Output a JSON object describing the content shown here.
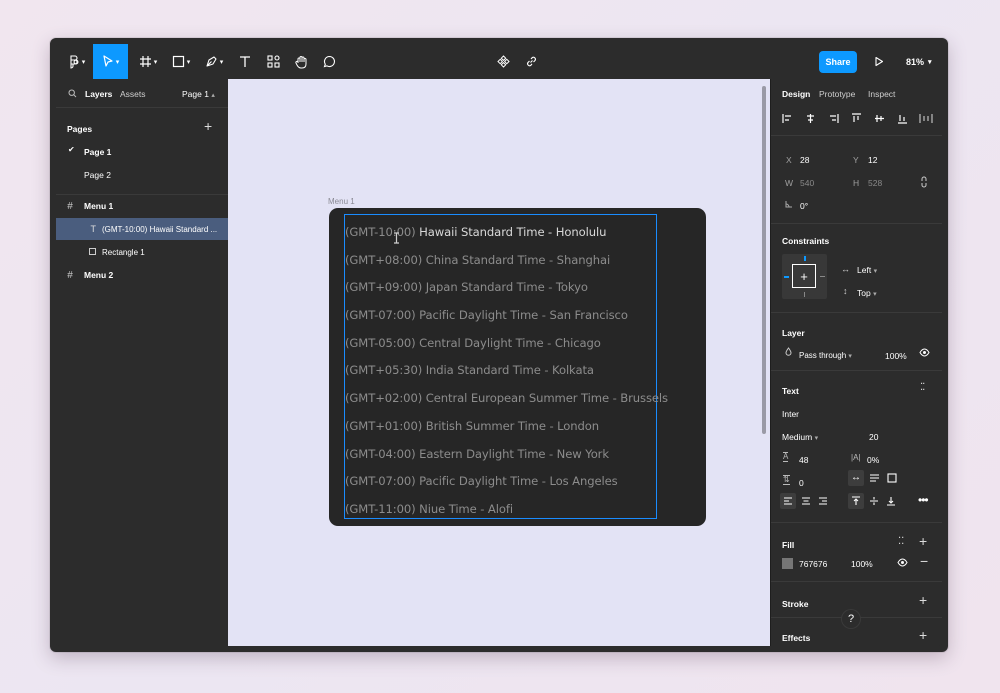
{
  "toolbar": {
    "share_label": "Share",
    "zoom_label": "81%"
  },
  "left_panel": {
    "tabs": {
      "layers": "Layers",
      "assets": "Assets",
      "page_selector": "Page 1"
    },
    "pages_title": "Pages",
    "pages": [
      "Page 1",
      "Page 2"
    ],
    "layers": [
      {
        "name": "Menu 1",
        "type": "frame"
      },
      {
        "name": "(GMT-10:00) Hawaii Standard ...",
        "type": "text",
        "selected": true
      },
      {
        "name": "Rectangle 1",
        "type": "rectangle"
      },
      {
        "name": "Menu 2",
        "type": "frame"
      }
    ]
  },
  "canvas": {
    "frame_label": "Menu 1",
    "timezones": [
      "(GMT-10:00) Hawaii Standard Time - Honolulu",
      "(GMT+08:00) China Standard Time - Shanghai",
      "(GMT+09:00) Japan Standard Time - Tokyo",
      "(GMT-07:00) Pacific Daylight Time - San Francisco",
      "(GMT-05:00) Central Daylight Time - Chicago",
      "(GMT+05:30) India Standard Time - Kolkata",
      "(GMT+02:00) Central European Summer Time - Brussels",
      "(GMT+01:00) British Summer Time - London",
      "(GMT-04:00) Eastern Daylight Time - New York",
      "(GMT-07:00) Pacific Daylight Time - Los Angeles",
      "(GMT-11:00) Niue Time - Alofi"
    ],
    "first_prefix": "(GMT-10:00)",
    "first_rest": " Hawaii Standard Time - Honolulu"
  },
  "right_panel": {
    "tabs": {
      "design": "Design",
      "prototype": "Prototype",
      "inspect": "Inspect"
    },
    "x_label": "X",
    "x_value": "28",
    "y_label": "Y",
    "y_value": "12",
    "w_label": "W",
    "w_value": "540",
    "h_label": "H",
    "h_value": "528",
    "rotation_value": "0°",
    "constraints_title": "Constraints",
    "constraint_h": "Left",
    "constraint_v": "Top",
    "layer_title": "Layer",
    "blend_mode": "Pass through",
    "layer_opacity": "100%",
    "text_title": "Text",
    "font_family": "Inter",
    "font_weight": "Medium",
    "font_size": "20",
    "line_height": "48",
    "letter_spacing": "0%",
    "paragraph_spacing": "0",
    "fill_title": "Fill",
    "fill_hex": "767676",
    "fill_opacity": "100%",
    "fill_color": "#767676",
    "stroke_title": "Stroke",
    "effects_title": "Effects",
    "help_label": "?"
  }
}
